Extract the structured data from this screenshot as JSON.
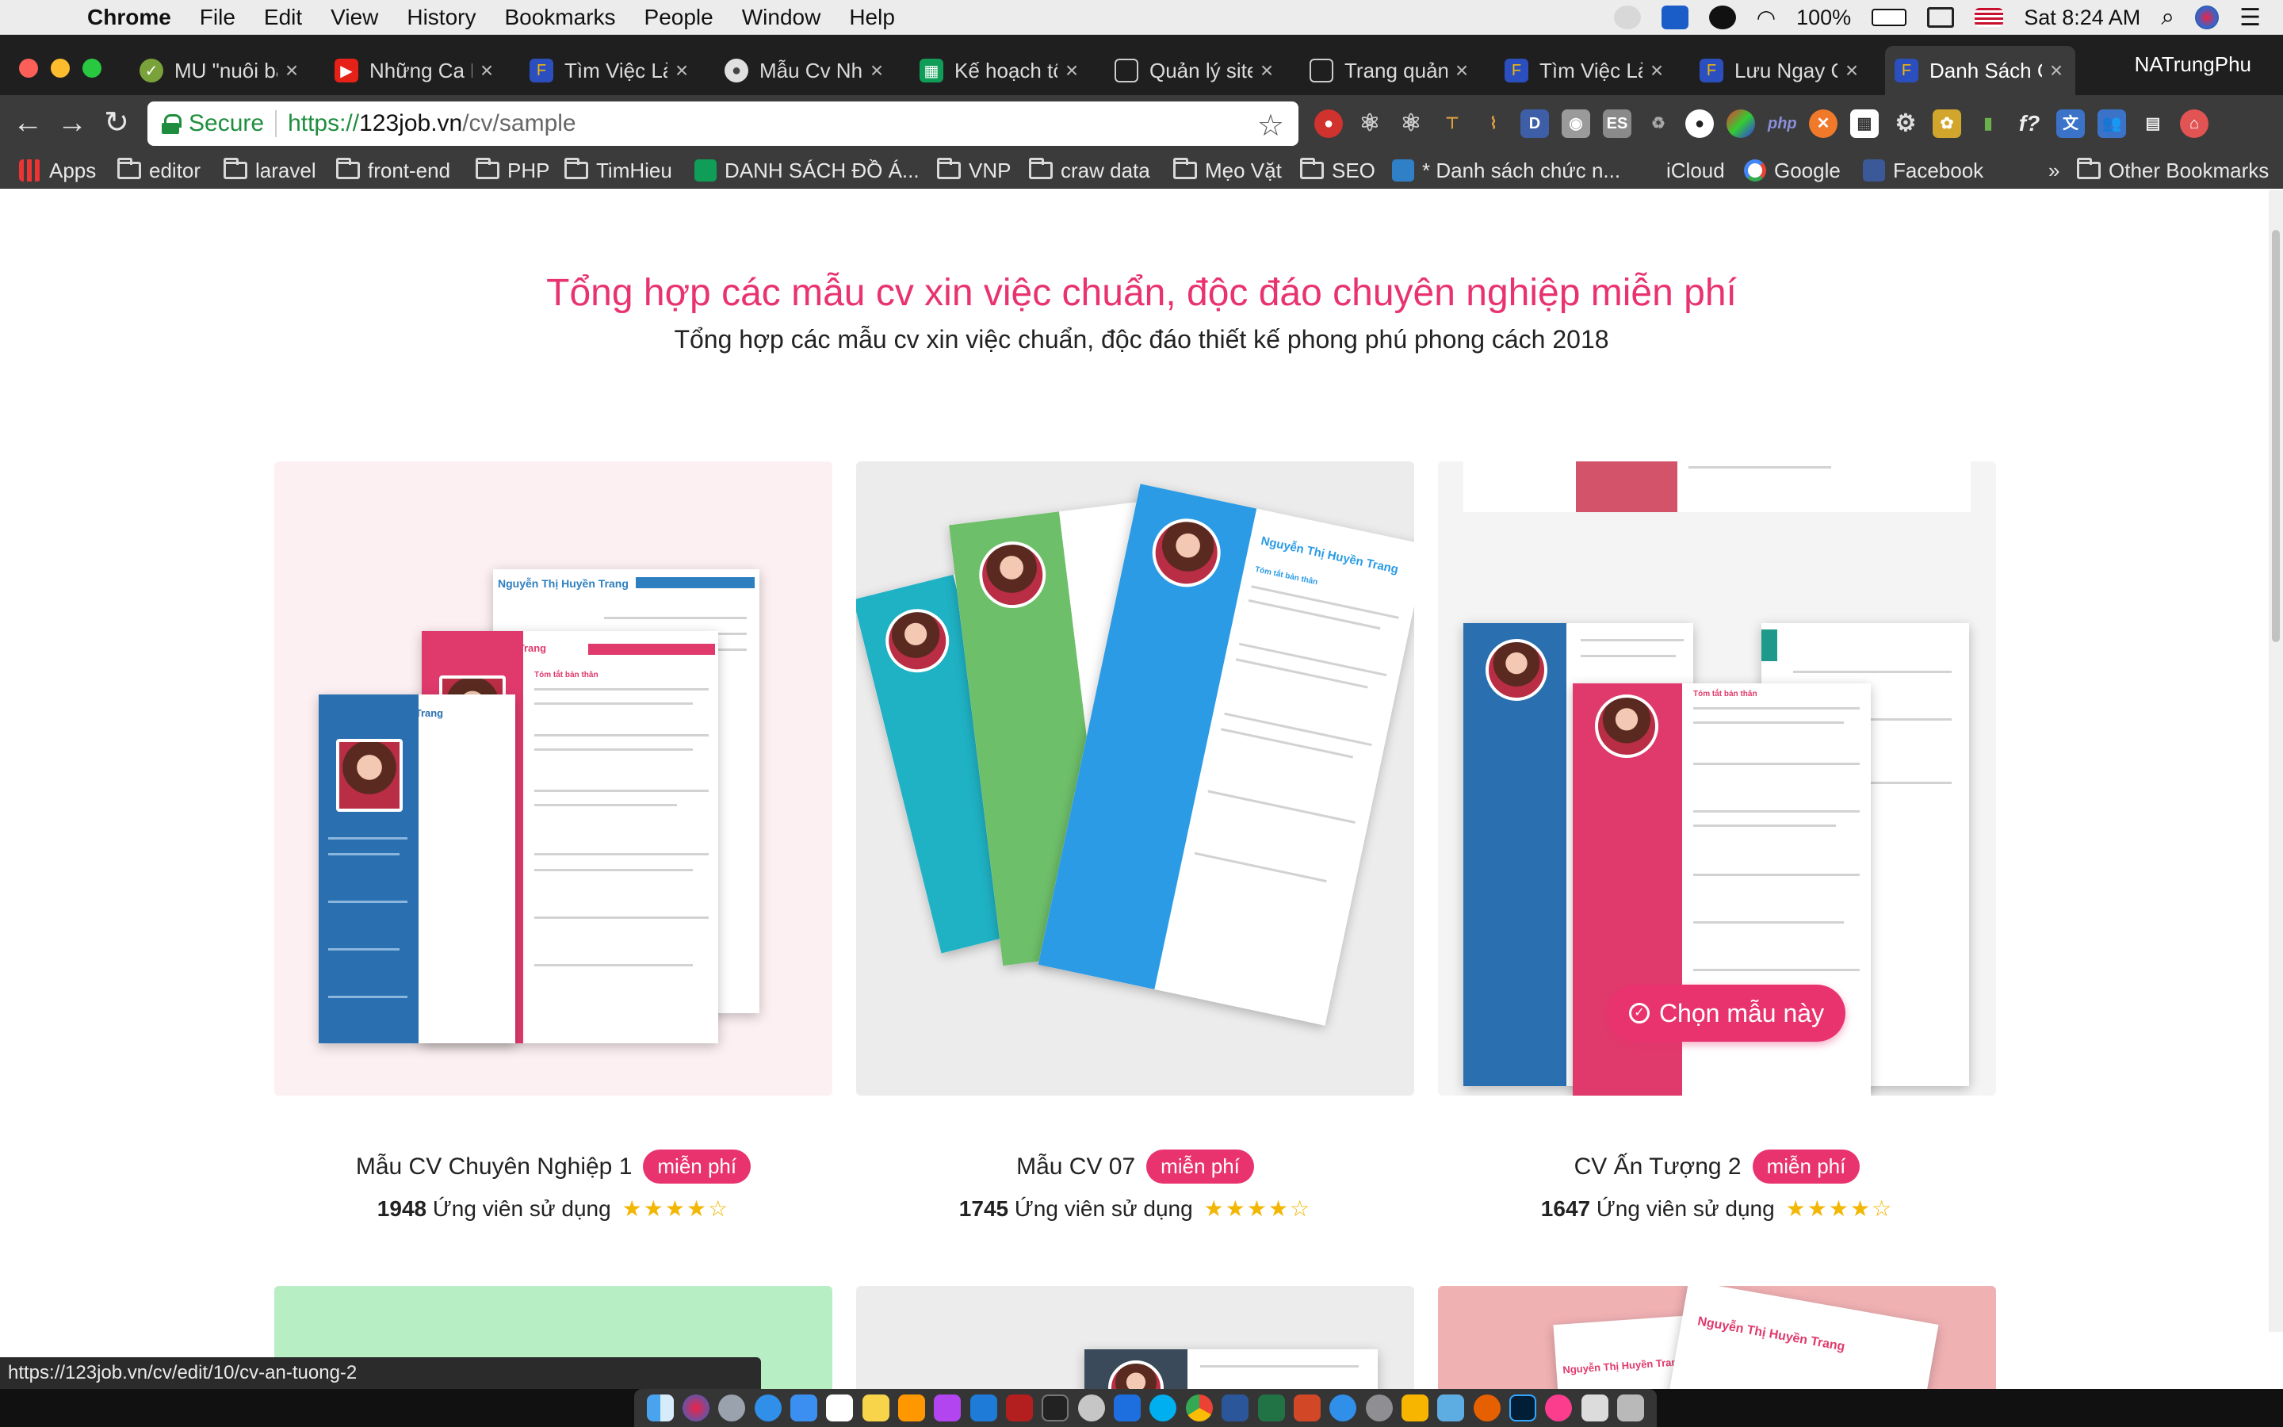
{
  "menubar": {
    "app": "Chrome",
    "items": [
      "File",
      "Edit",
      "View",
      "History",
      "Bookmarks",
      "People",
      "Window",
      "Help"
    ],
    "battery": "100%",
    "clock": "Sat 8:24 AM"
  },
  "tabs": [
    {
      "title": "MU \"nuôi bả",
      "color": "#7aa23a"
    },
    {
      "title": "Những Ca K",
      "color": "#e62117"
    },
    {
      "title": "Tìm Việc Là",
      "color": "#2c4fbf"
    },
    {
      "title": "Mẫu Cv Nhâ",
      "color": "#888888"
    },
    {
      "title": "Kế hoạch tố",
      "color": "#0f9d58"
    },
    {
      "title": "Quản lý site",
      "color": "#cccccc"
    },
    {
      "title": "Trang quản t",
      "color": "#cccccc"
    },
    {
      "title": "Tìm Việc Là",
      "color": "#2c4fbf"
    },
    {
      "title": "Lưu Ngay C",
      "color": "#2c4fbf"
    },
    {
      "title": "Danh Sách C",
      "color": "#2c4fbf"
    }
  ],
  "profile_name": "NATrungPhu",
  "omnibox": {
    "secure_label": "Secure",
    "scheme": "https://",
    "host": "123job.vn",
    "path": "/cv/sample"
  },
  "bookmarks": {
    "apps": "Apps",
    "items": [
      "editor",
      "laravel",
      "front-end",
      "PHP",
      "TimHieu",
      "DANH SÁCH ĐỒ Á...",
      "VNP",
      "craw data",
      "Mẹo Vặt",
      "SEO",
      "* Danh sách chức n...",
      "iCloud",
      "Google",
      "Facebook"
    ],
    "more": "»",
    "other": "Other Bookmarks"
  },
  "page": {
    "heading": "Tổng hợp các mẫu cv xin việc chuẩn, độc đáo chuyên nghiệp miễn phí",
    "subheading": "Tổng hợp các mẫu cv xin việc chuẩn, độc đáo thiết kế phong phú phong cách 2018",
    "cta": "Chọn mẫu này",
    "cards": [
      {
        "title": "Mẫu CV Chuyên Nghiệp 1",
        "badge": "miễn phí",
        "users": "1948",
        "users_label": "Ứng viên sử dụng",
        "rating": 4,
        "bg": "#fdf0f2"
      },
      {
        "title": "Mẫu CV 07",
        "badge": "miễn phí",
        "users": "1745",
        "users_label": "Ứng viên sử dụng",
        "rating": 4,
        "bg": "#ececec"
      },
      {
        "title": "CV Ấn Tượng 2",
        "badge": "miễn phí",
        "users": "1647",
        "users_label": "Ứng viên sử dụng",
        "rating": 4,
        "bg": "#f4f4f4"
      }
    ],
    "cv_name": "Nguyễn Thị Huyền Trang",
    "cv_section": "Tóm tắt bản thân"
  },
  "status_url": "https://123job.vn/cv/edit/10/cv-an-tuong-2",
  "colors": {
    "accent": "#e8336f",
    "star": "#f2b705"
  }
}
